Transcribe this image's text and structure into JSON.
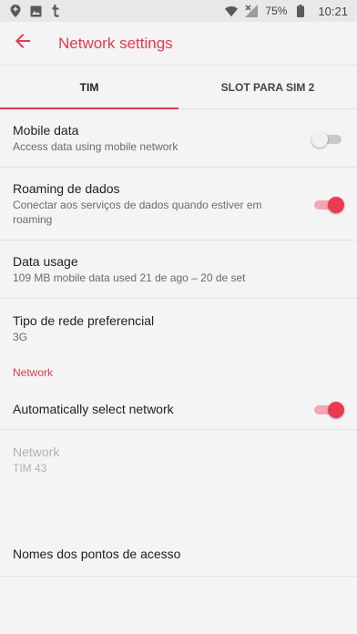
{
  "status_bar": {
    "battery": "75%",
    "time": "10:21"
  },
  "app_bar": {
    "title": "Network settings"
  },
  "tabs": [
    {
      "label": "TIM"
    },
    {
      "label": "SLOT PARA SIM 2"
    }
  ],
  "settings": {
    "mobile_data": {
      "title": "Mobile data",
      "subtitle": "Access data using mobile network",
      "enabled": false
    },
    "roaming": {
      "title": "Roaming de dados",
      "subtitle": "Conectar aos serviços de dados quando estiver em roaming",
      "enabled": true
    },
    "data_usage": {
      "title": "Data usage",
      "subtitle": "109 MB mobile data used 21 de ago – 20 de set"
    },
    "network_type": {
      "title": "Tipo de rede preferencial",
      "subtitle": "3G"
    },
    "network_section": {
      "header": "Network"
    },
    "auto_select": {
      "title": "Automatically select network",
      "enabled": true
    },
    "network": {
      "title": "Network",
      "subtitle": "TIM 43"
    },
    "apn": {
      "title": "Nomes dos pontos de acesso"
    }
  },
  "colors": {
    "accent": "#e8394f",
    "background": "#f4f4f4"
  }
}
